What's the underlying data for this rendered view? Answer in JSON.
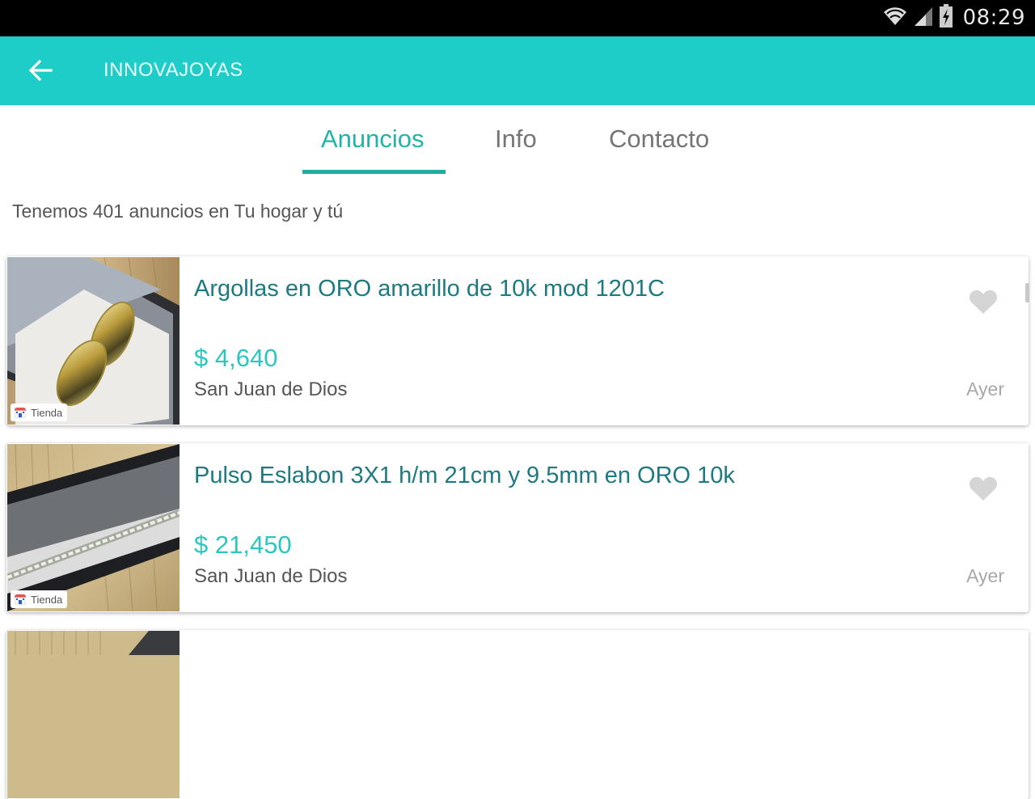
{
  "status_bar": {
    "time": "08:29",
    "icons": [
      "wifi-icon",
      "signal-icon",
      "battery-charging-icon"
    ]
  },
  "app_bar": {
    "back_icon": "arrow-left-icon",
    "title": "INNOVAJOYAS",
    "color": "#1ecdc7"
  },
  "tabs": [
    {
      "label": "Anuncios",
      "active": true
    },
    {
      "label": "Info",
      "active": false
    },
    {
      "label": "Contacto",
      "active": false
    }
  ],
  "summary": "Tenemos 401 anuncios en Tu hogar y tú",
  "listings": [
    {
      "title": "Argollas en ORO amarillo de 10k mod 1201C",
      "price": "$ 4,640",
      "location": "San Juan de Dios",
      "date": "Ayer",
      "badge": "Tienda",
      "favorite_icon": "heart-icon",
      "image_subject": "gold wedding rings in box"
    },
    {
      "title": "Pulso Eslabon 3X1 h/m 21cm y 9.5mm en ORO 10k",
      "price": "$ 21,450",
      "location": "San Juan de Dios",
      "date": "Ayer",
      "badge": "Tienda",
      "favorite_icon": "heart-icon",
      "image_subject": "chain bracelet in box"
    },
    {
      "title": "",
      "price": "",
      "location": "",
      "date": "",
      "badge": "",
      "favorite_icon": "heart-icon",
      "image_subject": "partially visible listing"
    }
  ],
  "colors": {
    "accent": "#1ecdc7",
    "tab_active": "#22b3a8",
    "listing_title": "#1c7a80",
    "price": "#2bc6c0"
  }
}
